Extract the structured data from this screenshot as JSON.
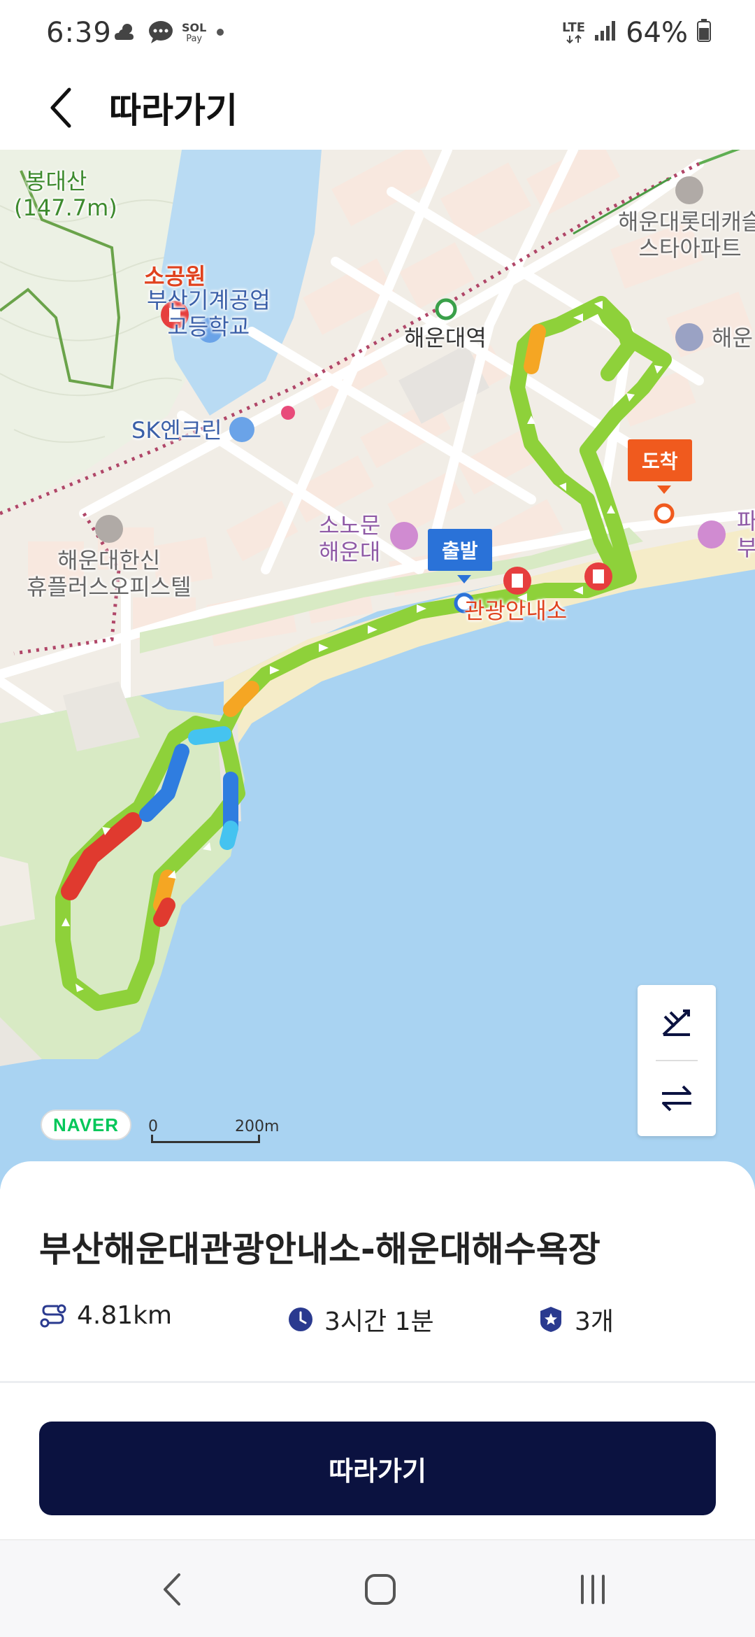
{
  "status_bar": {
    "time": "6:39",
    "network": "LTE",
    "battery": "64%",
    "app_icons": [
      "weather-icon",
      "chat-icon",
      "sol-pay-icon",
      "dot-icon"
    ],
    "sol_pay_top": "SOL",
    "sol_pay_bottom": "Pay"
  },
  "header": {
    "title": "따라가기"
  },
  "map": {
    "labels": {
      "mountain": "봉대산",
      "mountain_height": "(147.7m)",
      "park": "소공원",
      "school": "부산기계공업\n고등학교",
      "station": "해운대역",
      "sk": "SK엔크린",
      "apartment": "해운대롯데캐슬\n스타아파트",
      "haeun_right": "해운",
      "officetel": "해운대한신\n휴플러스오피스텔",
      "sonomun": "소노문\n해운대",
      "info_center": "관광안내소",
      "pa_right": "파\n부"
    },
    "start_flag": "출발",
    "end_flag": "도착",
    "brand": "NAVER",
    "scale_start": "0",
    "scale_end": "200m"
  },
  "route": {
    "title": "부산해운대관광안내소-해운대해수욕장",
    "distance": "4.81km",
    "duration": "3시간 1분",
    "stamps": "3개"
  },
  "actions": {
    "follow_label": "따라가기"
  },
  "colors": {
    "route_green": "#8ed13a",
    "route_orange": "#f5a623",
    "route_red": "#e03a2f",
    "route_blue": "#2f7de0",
    "route_cyan": "#45c3f0",
    "button_bg": "#0b1240",
    "sea": "#a9d3f2",
    "beach": "#f5ecc8"
  }
}
